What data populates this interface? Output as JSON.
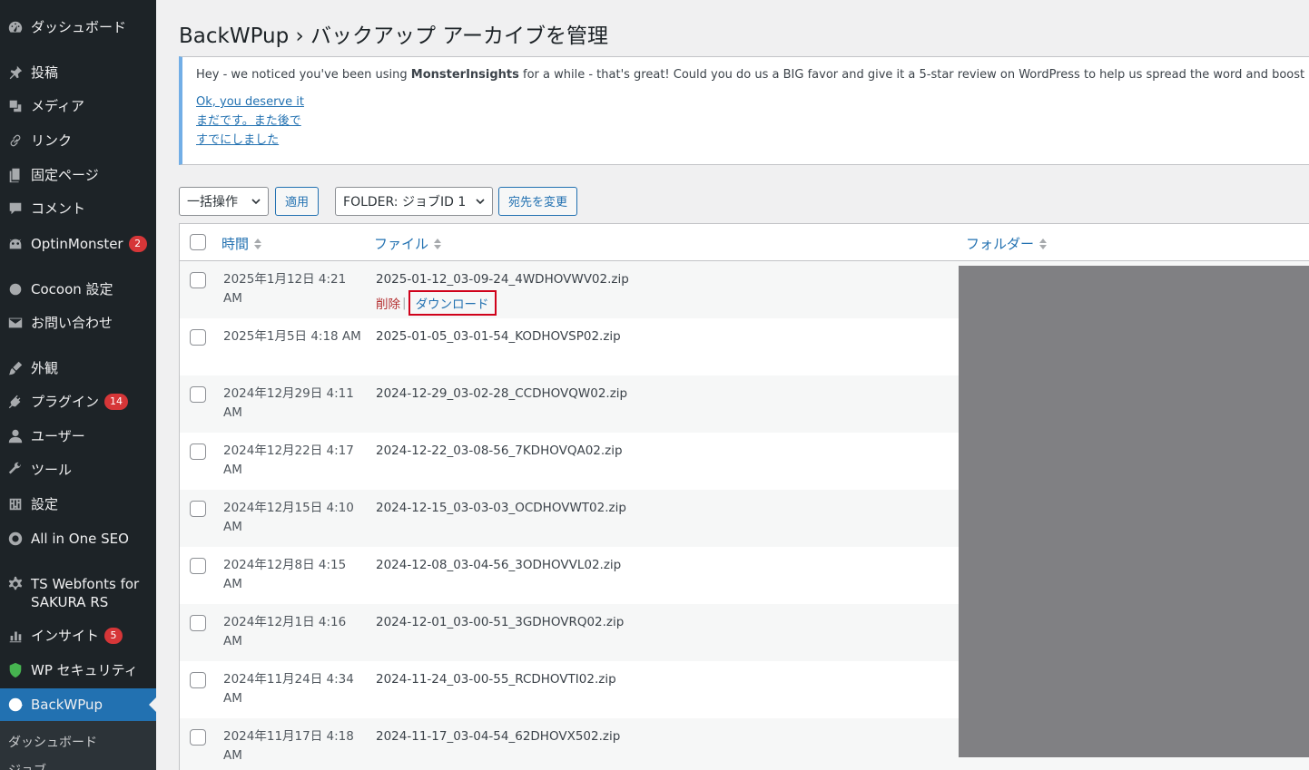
{
  "sidebar": {
    "items": [
      {
        "label": "ダッシュボード",
        "icon": "dashboard-icon",
        "badge": ""
      },
      {
        "label": "投稿",
        "icon": "pin-icon",
        "badge": ""
      },
      {
        "label": "メディア",
        "icon": "media-icon",
        "badge": ""
      },
      {
        "label": "リンク",
        "icon": "link-icon",
        "badge": ""
      },
      {
        "label": "固定ページ",
        "icon": "page-icon",
        "badge": ""
      },
      {
        "label": "コメント",
        "icon": "comment-icon",
        "badge": ""
      },
      {
        "label": "OptinMonster",
        "icon": "optinmonster-icon",
        "badge": "2"
      },
      {
        "label": "Cocoon 設定",
        "icon": "circle-icon",
        "badge": ""
      },
      {
        "label": "お問い合わせ",
        "icon": "mail-icon",
        "badge": ""
      },
      {
        "label": "外観",
        "icon": "brush-icon",
        "badge": ""
      },
      {
        "label": "プラグイン",
        "icon": "plugin-icon",
        "badge": "14"
      },
      {
        "label": "ユーザー",
        "icon": "user-icon",
        "badge": ""
      },
      {
        "label": "ツール",
        "icon": "wrench-icon",
        "badge": ""
      },
      {
        "label": "設定",
        "icon": "settings-icon",
        "badge": ""
      },
      {
        "label": "All in One SEO",
        "icon": "aioseo-icon",
        "badge": ""
      },
      {
        "label": "TS Webfonts for SAKURA RS",
        "icon": "gear-icon",
        "badge": ""
      },
      {
        "label": "インサイト",
        "icon": "insights-icon",
        "badge": "5"
      },
      {
        "label": "WP セキュリティ",
        "icon": "shield-icon",
        "badge": ""
      },
      {
        "label": "BackWPup",
        "icon": "backwpup-icon",
        "badge": ""
      }
    ],
    "submenu": [
      "ダッシュボード",
      "ジョブ"
    ]
  },
  "page": {
    "title": "BackWPup › バックアップ アーカイブを管理"
  },
  "notice": {
    "text_before": "Hey - we noticed you've been using ",
    "brand": "MonsterInsights",
    "text_after": " for a while - that's great! Could you do us a BIG favor and give it a 5-star review on WordPress to help us spread the word and boost our mot",
    "links": [
      "Ok, you deserve it",
      "まだです。また後で",
      "すでにしました"
    ]
  },
  "tablenav": {
    "bulk_select": "一括操作",
    "apply": "適用",
    "folder_select": "FOLDER: ジョブID 1",
    "change_dest": "宛先を変更"
  },
  "table": {
    "columns": [
      "時間",
      "ファイル",
      "フォルダー"
    ],
    "row_actions": {
      "delete": "削除",
      "download": "ダウンロード"
    },
    "rows": [
      {
        "date": "2025年1月12日 4:21 AM",
        "file": "2025-01-12_03-09-24_4WDHOVWV02.zip"
      },
      {
        "date": "2025年1月5日 4:18 AM",
        "file": "2025-01-05_03-01-54_KODHOVSP02.zip"
      },
      {
        "date": "2024年12月29日 4:11 AM",
        "file": "2024-12-29_03-02-28_CCDHOVQW02.zip"
      },
      {
        "date": "2024年12月22日 4:17 AM",
        "file": "2024-12-22_03-08-56_7KDHOVQA02.zip"
      },
      {
        "date": "2024年12月15日 4:10 AM",
        "file": "2024-12-15_03-03-03_OCDHOVWT02.zip"
      },
      {
        "date": "2024年12月8日 4:15 AM",
        "file": "2024-12-08_03-04-56_3ODHOVVL02.zip"
      },
      {
        "date": "2024年12月1日 4:16 AM",
        "file": "2024-12-01_03-00-51_3GDHOVRQ02.zip"
      },
      {
        "date": "2024年11月24日 4:34 AM",
        "file": "2024-11-24_03-00-55_RCDHOVTI02.zip"
      },
      {
        "date": "2024年11月17日 4:18 AM",
        "file": "2024-11-17_03-04-54_62DHOVX502.zip"
      }
    ]
  },
  "colors": {
    "sidebar_bg": "#1d2327",
    "accent": "#2271b1",
    "badge": "#d63638",
    "delete": "#b32d2e",
    "highlight_box": "#d0021b"
  }
}
